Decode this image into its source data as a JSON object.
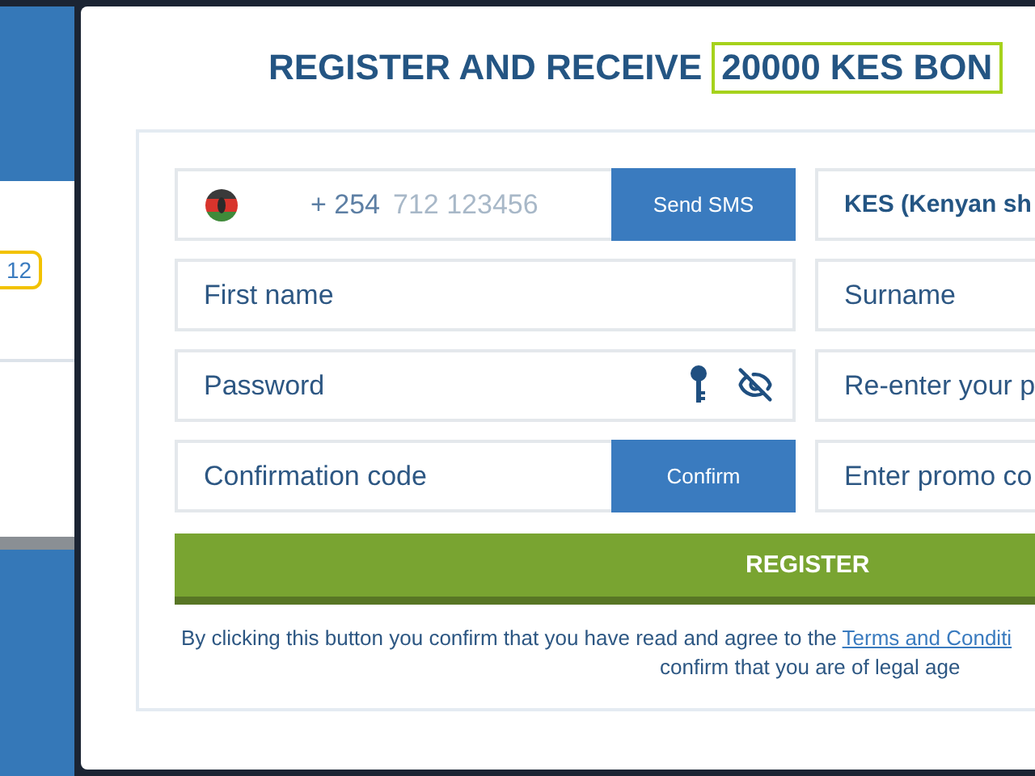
{
  "backdrop": {
    "badge": "12"
  },
  "title": {
    "text": "REGISTER AND RECEIVE",
    "highlight": "20000 KES BON"
  },
  "phone": {
    "code": "+ 254",
    "placeholder": "712 123456",
    "button": "Send SMS"
  },
  "currency": {
    "value": "KES (Kenyan sh"
  },
  "fields": [
    {
      "kind": "text",
      "placeholder": "First name"
    },
    {
      "kind": "text",
      "placeholder": "Surname"
    },
    {
      "kind": "password",
      "placeholder": "Password"
    },
    {
      "kind": "text",
      "placeholder": "Re-enter your p"
    },
    {
      "kind": "code",
      "placeholder": "Confirmation code",
      "button": "Confirm"
    },
    {
      "kind": "text",
      "placeholder": "Enter promo co"
    }
  ],
  "register_button": "REGISTER",
  "terms": {
    "text": "By clicking this button you confirm that you have read and agree to the",
    "link": "Terms and Conditi",
    "line2": "confirm that you are of legal age"
  }
}
